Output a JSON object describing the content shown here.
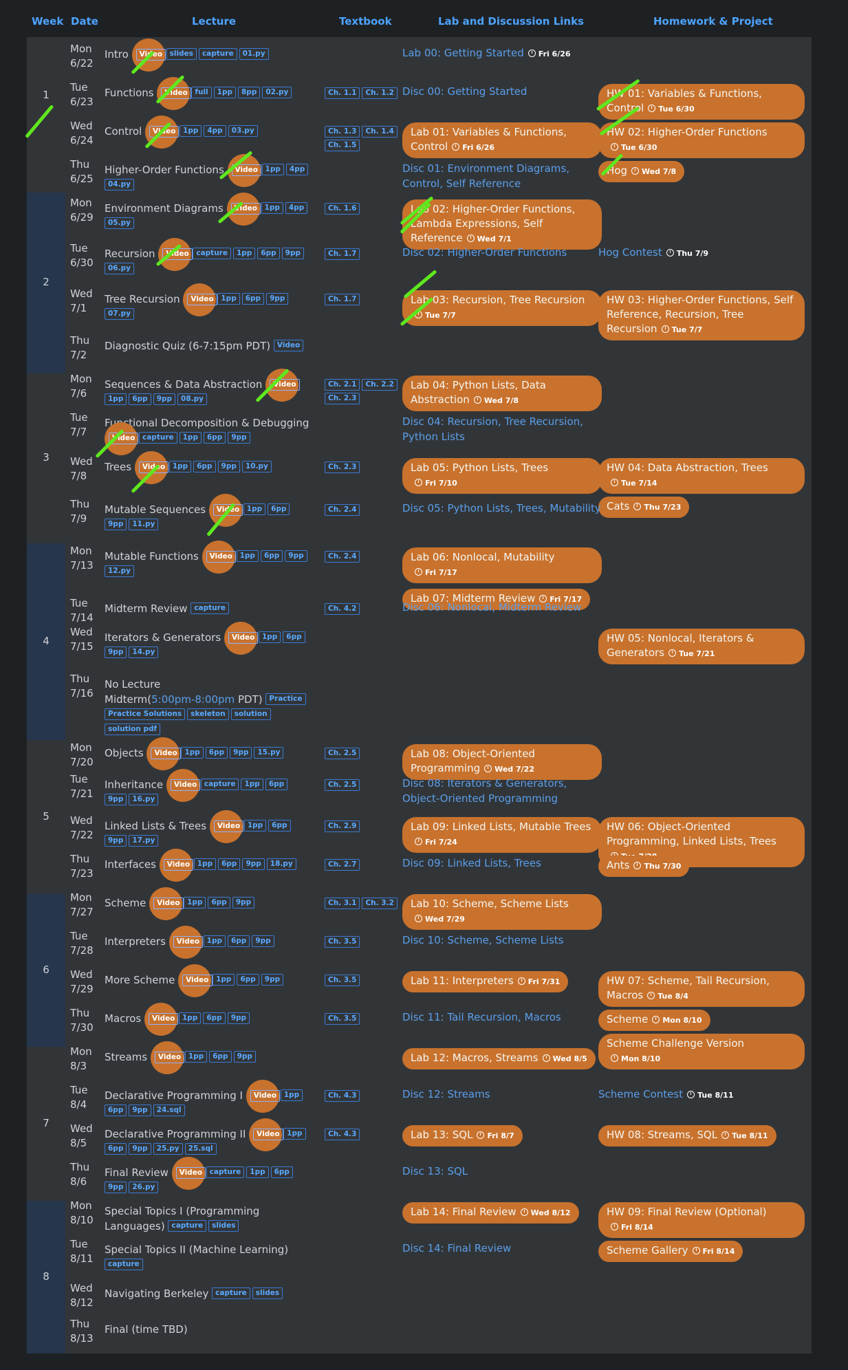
{
  "headers": {
    "week": "Week",
    "date": "Date",
    "lecture": "Lecture",
    "textbook": "Textbook",
    "lab": "Lab and Discussion Links",
    "hw": "Homework & Project"
  },
  "weeks": [
    "1",
    "2",
    "3",
    "4",
    "5",
    "6",
    "7",
    "8"
  ],
  "rows": [
    {
      "day": "Mon",
      "date": "6/22",
      "lecture": "Intro",
      "video": true,
      "tags": [
        "slides",
        "capture",
        "01.py"
      ],
      "textbook": [],
      "lab": {
        "text": "Lab 00: Getting Started",
        "pill": false,
        "due": "Fri 6/26"
      },
      "hw": null
    },
    {
      "day": "Tue",
      "date": "6/23",
      "lecture": "Functions",
      "video": true,
      "tags": [
        "full",
        "1pp",
        "8pp",
        "02.py"
      ],
      "textbook": [
        "Ch. 1.1",
        "Ch. 1.2"
      ],
      "lab": {
        "text": "Disc 00: Getting Started",
        "pill": false,
        "due": ""
      },
      "hw": [
        {
          "text": "HW 01: Variables & Functions, Control",
          "due": "Tue 6/30"
        }
      ]
    },
    {
      "day": "Wed",
      "date": "6/24",
      "lecture": "Control",
      "video": true,
      "tags": [
        "1pp",
        "4pp",
        "03.py"
      ],
      "textbook": [
        "Ch. 1.3",
        "Ch. 1.4",
        "Ch. 1.5"
      ],
      "lab": {
        "text": "Lab 01: Variables & Functions, Control",
        "pill": true,
        "due": "Fri 6/26"
      },
      "hw": [
        {
          "text": "HW 02: Higher-Order Functions",
          "due": "Tue 6/30"
        }
      ]
    },
    {
      "day": "Thu",
      "date": "6/25",
      "lecture": "Higher-Order Functions",
      "video": true,
      "tags": [
        "1pp",
        "4pp",
        "04.py"
      ],
      "textbook": [],
      "lab": {
        "text": "Disc 01: Environment Diagrams, Control, Self Reference",
        "pill": false,
        "due": ""
      },
      "hw": [
        {
          "text": "Hog",
          "due": "Wed 7/8"
        }
      ]
    },
    {
      "day": "Mon",
      "date": "6/29",
      "lecture": "Environment Diagrams",
      "video": true,
      "tags": [
        "1pp",
        "4pp",
        "05.py"
      ],
      "textbook": [
        "Ch. 1.6"
      ],
      "lab": {
        "text": "Lab 02: Higher-Order Functions, Lambda Expressions, Self Reference",
        "pill": true,
        "due": "Wed 7/1"
      },
      "hw": null
    },
    {
      "day": "Tue",
      "date": "6/30",
      "lecture": "Recursion",
      "video": true,
      "tags": [
        "capture",
        "1pp",
        "6pp",
        "9pp",
        "06.py"
      ],
      "textbook": [
        "Ch. 1.7"
      ],
      "lab": {
        "text": "Disc 02: Higher-Order Functions",
        "pill": false,
        "due": ""
      },
      "hw": [
        {
          "text": "Hog Contest",
          "due": "Thu 7/9",
          "plain": true
        }
      ]
    },
    {
      "day": "Wed",
      "date": "7/1",
      "lecture": "Tree Recursion",
      "video": true,
      "tags": [
        "1pp",
        "6pp",
        "9pp",
        "07.py"
      ],
      "textbook": [
        "Ch. 1.7"
      ],
      "lab": {
        "text": "Lab 03: Recursion, Tree Recursion",
        "pill": true,
        "due": "Tue 7/7"
      },
      "hw": [
        {
          "text": "HW 03: Higher-Order Functions, Self Reference, Recursion, Tree Recursion",
          "due": "Tue 7/7"
        }
      ]
    },
    {
      "day": "Thu",
      "date": "7/2",
      "lecture": "Diagnostic Quiz (6-7:15pm PDT)",
      "video": false,
      "tags": [
        "Video"
      ],
      "textbook": [],
      "lab": null,
      "hw": null
    },
    {
      "day": "Mon",
      "date": "7/6",
      "lecture": "Sequences & Data Abstraction",
      "video": true,
      "tags": [
        "1pp",
        "6pp",
        "9pp",
        "08.py"
      ],
      "textbook": [
        "Ch. 2.1",
        "Ch. 2.2",
        "Ch. 2.3"
      ],
      "lab": {
        "text": "Lab 04: Python Lists, Data Abstraction",
        "pill": true,
        "due": "Wed 7/8"
      },
      "hw": null
    },
    {
      "day": "Tue",
      "date": "7/7",
      "lecture": "Functional Decomposition & Debugging",
      "video": true,
      "tags": [
        "capture",
        "1pp",
        "6pp",
        "9pp"
      ],
      "textbook": [],
      "lab": {
        "text": "Disc 04: Recursion, Tree Recursion, Python Lists",
        "pill": false,
        "due": ""
      },
      "hw": null
    },
    {
      "day": "Wed",
      "date": "7/8",
      "lecture": "Trees",
      "video": true,
      "tags": [
        "1pp",
        "6pp",
        "9pp",
        "10.py"
      ],
      "textbook": [
        "Ch. 2.3"
      ],
      "lab": {
        "text": "Lab 05: Python Lists, Trees",
        "pill": true,
        "due": "Fri 7/10"
      },
      "hw": [
        {
          "text": "HW 04: Data Abstraction, Trees",
          "due": "Tue 7/14"
        },
        {
          "text": "Cats",
          "due": "Thu 7/23"
        }
      ]
    },
    {
      "day": "Thu",
      "date": "7/9",
      "lecture": "Mutable Sequences",
      "video": true,
      "tags": [
        "1pp",
        "6pp",
        "9pp",
        "11.py"
      ],
      "textbook": [
        "Ch. 2.4"
      ],
      "lab": {
        "text": "Disc 05: Python Lists, Trees, Mutability",
        "pill": false,
        "due": ""
      },
      "hw": null
    },
    {
      "day": "Mon",
      "date": "7/13",
      "lecture": "Mutable Functions",
      "video": true,
      "tags": [
        "1pp",
        "6pp",
        "9pp",
        "12.py"
      ],
      "textbook": [
        "Ch. 2.4"
      ],
      "lab": {
        "text": "Lab 06: Nonlocal, Mutability",
        "pill": true,
        "due": "Fri 7/17",
        "extra": {
          "text": "Lab 07: Midterm Review",
          "due": "Fri 7/17"
        }
      },
      "hw": null
    },
    {
      "day": "Tue",
      "date": "7/14",
      "lecture": "Midterm Review",
      "video": false,
      "tags": [
        "capture"
      ],
      "textbook": [
        "Ch. 4.2"
      ],
      "lab": {
        "text": "Disc 06: Nonlocal, Midterm Review",
        "pill": false,
        "due": ""
      },
      "hw": null
    },
    {
      "day": "Wed",
      "date": "7/15",
      "lecture": "Iterators & Generators",
      "video": true,
      "tags": [
        "1pp",
        "6pp",
        "9pp",
        "14.py"
      ],
      "textbook": [],
      "lab": null,
      "hw": [
        {
          "text": "HW 05: Nonlocal, Iterators & Generators",
          "due": "Tue 7/21"
        }
      ]
    },
    {
      "day": "Thu",
      "date": "7/16",
      "lecture": "No Lecture",
      "midterm": {
        "pre": "Midterm(",
        "time": "5:00pm-8:00pm",
        "post": " PDT)"
      },
      "video": false,
      "tags": [
        "Practice",
        "Practice Solutions",
        "skeleton",
        "solution",
        "solution pdf"
      ],
      "textbook": [],
      "lab": null,
      "hw": null
    },
    {
      "day": "Mon",
      "date": "7/20",
      "lecture": "Objects",
      "video": true,
      "tags": [
        "1pp",
        "6pp",
        "9pp",
        "15.py"
      ],
      "textbook": [
        "Ch. 2.5"
      ],
      "lab": {
        "text": "Lab 08: Object-Oriented Programming",
        "pill": true,
        "due": "Wed 7/22"
      },
      "hw": null
    },
    {
      "day": "Tue",
      "date": "7/21",
      "lecture": "Inheritance",
      "video": true,
      "tags": [
        "capture",
        "1pp",
        "6pp",
        "9pp",
        "16.py"
      ],
      "textbook": [
        "Ch. 2.5"
      ],
      "lab": {
        "text": "Disc 08: Iterators & Generators, Object-Oriented Programming",
        "pill": false,
        "due": ""
      },
      "hw": null
    },
    {
      "day": "Wed",
      "date": "7/22",
      "lecture": "Linked Lists & Trees",
      "video": true,
      "tags": [
        "1pp",
        "6pp",
        "9pp",
        "17.py"
      ],
      "textbook": [
        "Ch. 2.9"
      ],
      "lab": {
        "text": "Lab 09: Linked Lists, Mutable Trees",
        "pill": true,
        "due": "Fri 7/24"
      },
      "hw": [
        {
          "text": "HW 06: Object-Oriented Programming, Linked Lists, Trees",
          "due": "Tue 7/28"
        }
      ]
    },
    {
      "day": "Thu",
      "date": "7/23",
      "lecture": "Interfaces",
      "video": true,
      "tags": [
        "1pp",
        "6pp",
        "9pp",
        "18.py"
      ],
      "textbook": [
        "Ch. 2.7"
      ],
      "lab": {
        "text": "Disc 09: Linked Lists, Trees",
        "pill": false,
        "due": ""
      },
      "hw": [
        {
          "text": "Ants",
          "due": "Thu 7/30"
        }
      ]
    },
    {
      "day": "Mon",
      "date": "7/27",
      "lecture": "Scheme",
      "video": true,
      "tags": [
        "1pp",
        "6pp",
        "9pp"
      ],
      "textbook": [
        "Ch. 3.1",
        "Ch. 3.2"
      ],
      "lab": {
        "text": "Lab 10: Scheme, Scheme Lists",
        "pill": true,
        "due": "Wed 7/29"
      },
      "hw": null
    },
    {
      "day": "Tue",
      "date": "7/28",
      "lecture": "Interpreters",
      "video": true,
      "tags": [
        "1pp",
        "6pp",
        "9pp"
      ],
      "textbook": [
        "Ch. 3.5"
      ],
      "lab": {
        "text": "Disc 10: Scheme, Scheme Lists",
        "pill": false,
        "due": ""
      },
      "hw": null
    },
    {
      "day": "Wed",
      "date": "7/29",
      "lecture": "More Scheme",
      "video": true,
      "tags": [
        "1pp",
        "6pp",
        "9pp"
      ],
      "textbook": [
        "Ch. 3.5"
      ],
      "lab": {
        "text": "Lab 11: Interpreters",
        "pill": true,
        "due": "Fri 7/31"
      },
      "hw": [
        {
          "text": "HW 07: Scheme, Tail Recursion, Macros",
          "due": "Tue 8/4"
        }
      ]
    },
    {
      "day": "Thu",
      "date": "7/30",
      "lecture": "Macros",
      "video": true,
      "tags": [
        "1pp",
        "6pp",
        "9pp"
      ],
      "textbook": [
        "Ch. 3.5"
      ],
      "lab": {
        "text": "Disc 11: Tail Recursion, Macros",
        "pill": false,
        "due": ""
      },
      "hw": [
        {
          "text": "Scheme",
          "due": "Mon 8/10"
        },
        {
          "text": "Scheme Challenge Version",
          "due": "Mon 8/10"
        }
      ]
    },
    {
      "day": "Mon",
      "date": "8/3",
      "lecture": "Streams",
      "video": true,
      "tags": [
        "1pp",
        "6pp",
        "9pp"
      ],
      "textbook": [],
      "lab": {
        "text": "Lab 12: Macros, Streams",
        "pill": true,
        "due": "Wed 8/5"
      },
      "hw": null
    },
    {
      "day": "Tue",
      "date": "8/4",
      "lecture": "Declarative Programming I",
      "video": true,
      "tags": [
        "1pp",
        "6pp",
        "9pp",
        "24.sql"
      ],
      "textbook": [
        "Ch. 4.3"
      ],
      "lab": {
        "text": "Disc 12: Streams",
        "pill": false,
        "due": ""
      },
      "hw": [
        {
          "text": "Scheme Contest",
          "due": "Tue 8/11",
          "plain": true
        }
      ]
    },
    {
      "day": "Wed",
      "date": "8/5",
      "lecture": "Declarative Programming II",
      "video": true,
      "tags": [
        "1pp",
        "6pp",
        "9pp",
        "25.py",
        "25.sql"
      ],
      "textbook": [
        "Ch. 4.3"
      ],
      "lab": {
        "text": "Lab 13: SQL",
        "pill": true,
        "due": "Fri 8/7"
      },
      "hw": [
        {
          "text": "HW 08: Streams, SQL",
          "due": "Tue 8/11"
        }
      ]
    },
    {
      "day": "Thu",
      "date": "8/6",
      "lecture": "Final Review",
      "video": true,
      "tags": [
        "capture",
        "1pp",
        "6pp",
        "9pp",
        "26.py"
      ],
      "textbook": [],
      "lab": {
        "text": "Disc 13: SQL",
        "pill": false,
        "due": ""
      },
      "hw": null
    },
    {
      "day": "Mon",
      "date": "8/10",
      "lecture": "Special Topics I (Programming Languages)",
      "video": false,
      "tags": [
        "capture",
        "slides"
      ],
      "textbook": [],
      "lab": {
        "text": "Lab 14: Final Review",
        "pill": true,
        "due": "Wed 8/12"
      },
      "hw": [
        {
          "text": "HW 09: Final Review (Optional)",
          "due": "Fri 8/14"
        }
      ]
    },
    {
      "day": "Tue",
      "date": "8/11",
      "lecture": "Special Topics II (Machine Learning)",
      "video": false,
      "tags": [
        "capture"
      ],
      "textbook": [],
      "lab": {
        "text": "Disc 14: Final Review",
        "pill": false,
        "due": ""
      },
      "hw": [
        {
          "text": "Scheme Gallery",
          "due": "Fri 8/14"
        }
      ]
    },
    {
      "day": "Wed",
      "date": "8/12",
      "lecture": "Navigating Berkeley",
      "video": false,
      "tags": [
        "capture",
        "slides"
      ],
      "textbook": [],
      "lab": null,
      "hw": null
    },
    {
      "day": "Thu",
      "date": "8/13",
      "lecture": "Final (time TBD)",
      "video": false,
      "tags": [],
      "textbook": [],
      "lab": null,
      "hw": null
    }
  ],
  "video_label": "Video",
  "colors": {
    "pill": "#c8722d",
    "link": "#5a9eea",
    "strike": "#5fe81e",
    "week_dark": "#25364d",
    "panel": "#323538"
  }
}
